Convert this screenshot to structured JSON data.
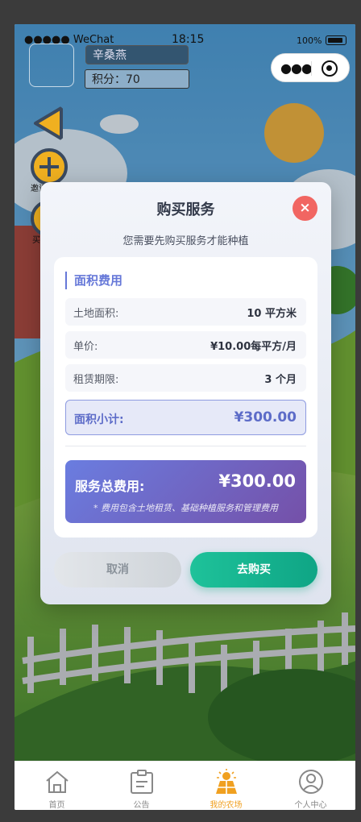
{
  "status_bar": {
    "carrier": "●●●●● WeChat",
    "time": "18:15",
    "battery_pct": "100%"
  },
  "player": {
    "name": "辛桑燕",
    "points": "积分：70"
  },
  "side_buttons": {
    "invite_label": "邀请好友",
    "buy_label": "买"
  },
  "modal": {
    "title": "购买服务",
    "close_icon": "×",
    "subtitle": "您需要先购买服务才能种植",
    "section_title": "面积费用",
    "rows": [
      {
        "label": "土地面积:",
        "value": "10 平方米"
      },
      {
        "label": "单价:",
        "value": "¥10.00每平方/月"
      },
      {
        "label": "租赁期限:",
        "value": "3 个月"
      }
    ],
    "subtotal": {
      "label": "面积小计:",
      "value": "¥300.00"
    },
    "total": {
      "label": "服务总费用:",
      "value": "¥300.00",
      "note": "* 费用包含土地租赁、基础种植服务和管理费用"
    },
    "cancel_label": "取消",
    "buy_label": "去购买"
  },
  "tabbar": {
    "items": [
      {
        "label": "首页",
        "icon": "home-icon"
      },
      {
        "label": "公告",
        "icon": "notice-icon"
      },
      {
        "label": "我的农场",
        "icon": "farm-icon"
      },
      {
        "label": "个人中心",
        "icon": "user-icon"
      }
    ],
    "active_index": 2,
    "active_color": "#f0a020"
  },
  "colors": {
    "accent": "#6678d8",
    "buy": "#12b08e",
    "close": "#f16662"
  }
}
